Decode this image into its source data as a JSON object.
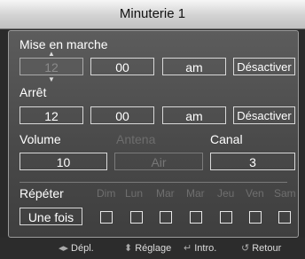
{
  "title": "Minuterie 1",
  "mise_en_marche": {
    "label": "Mise en marche",
    "hour": "12",
    "minute": "00",
    "ampm": "am",
    "status": "Désactiver"
  },
  "arret": {
    "label": "Arrêt",
    "hour": "12",
    "minute": "00",
    "ampm": "am",
    "status": "Désactiver"
  },
  "volume": {
    "label": "Volume",
    "value": "10"
  },
  "antena": {
    "label": "Antena",
    "value": "Air"
  },
  "canal": {
    "label": "Canal",
    "value": "3"
  },
  "repeter": {
    "label": "Répéter",
    "mode": "Une fois",
    "days": [
      "Dim",
      "Lun",
      "Mar",
      "Mar",
      "Jeu",
      "Ven",
      "Sam"
    ]
  },
  "footer": {
    "move": "Dépl.",
    "adjust": "Réglage",
    "enter": "Intro.",
    "return": "Retour"
  }
}
